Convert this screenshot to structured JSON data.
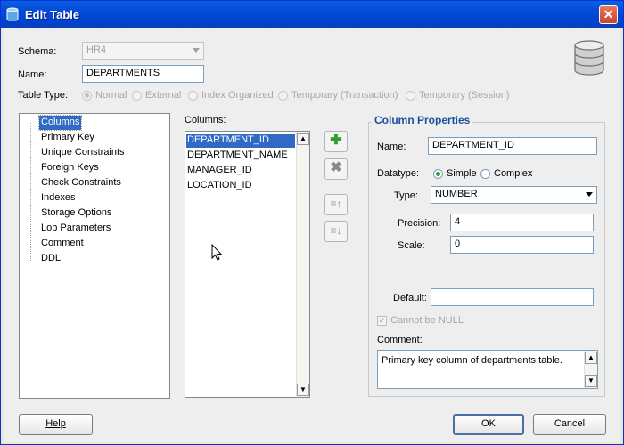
{
  "window": {
    "title": "Edit Table",
    "close": "✕"
  },
  "schema": {
    "label": "Schema:",
    "value": "HR4"
  },
  "name": {
    "label": "Name:",
    "value": "DEPARTMENTS"
  },
  "table_type": {
    "label": "Table Type:",
    "options": [
      "Normal",
      "External",
      "Index Organized",
      "Temporary (Transaction)",
      "Temporary (Session)"
    ],
    "selected": "Normal"
  },
  "tree": {
    "items": [
      "Columns",
      "Primary Key",
      "Unique Constraints",
      "Foreign Keys",
      "Check Constraints",
      "Indexes",
      "Storage Options",
      "Lob Parameters",
      "Comment",
      "DDL"
    ],
    "selected": "Columns"
  },
  "columns": {
    "label": "Columns:",
    "items": [
      "DEPARTMENT_ID",
      "DEPARTMENT_NAME",
      "MANAGER_ID",
      "LOCATION_ID"
    ],
    "selected": "DEPARTMENT_ID"
  },
  "column_properties": {
    "title": "Column Properties",
    "name_label": "Name:",
    "name_value": "DEPARTMENT_ID",
    "datatype_label": "Datatype:",
    "datatype_simple": "Simple",
    "datatype_complex": "Complex",
    "type_label": "Type:",
    "type_value": "NUMBER",
    "precision_label": "Precision:",
    "precision_value": "4",
    "scale_label": "Scale:",
    "scale_value": "0",
    "default_label": "Default:",
    "default_value": "",
    "not_null_label": "Cannot be NULL",
    "comment_label": "Comment:",
    "comment_value": "Primary key column of departments table."
  },
  "buttons": {
    "help": "Help",
    "ok": "OK",
    "cancel": "Cancel"
  },
  "colors": {
    "accent": "#316AC5",
    "titlebar": "#0449D9",
    "add_icon": "#2E9E2E",
    "remove_icon": "#8A8A8A"
  }
}
